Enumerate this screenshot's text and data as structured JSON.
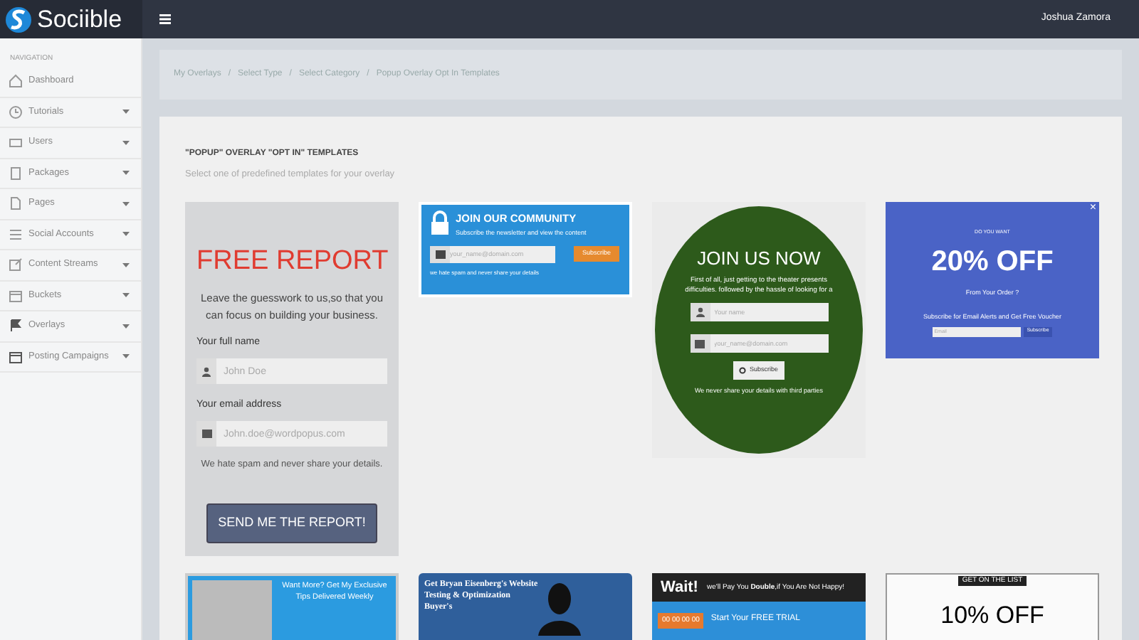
{
  "topbar": {
    "logo": "Sociible",
    "user": "Joshua Zamora"
  },
  "sidebar": {
    "heading": "NAVIGATION",
    "items": [
      {
        "label": "Dashboard",
        "expandable": false
      },
      {
        "label": "Tutorials",
        "expandable": true
      },
      {
        "label": "Users",
        "expandable": true
      },
      {
        "label": "Packages",
        "expandable": true
      },
      {
        "label": "Pages",
        "expandable": true
      },
      {
        "label": "Social Accounts",
        "expandable": true
      },
      {
        "label": "Content Streams",
        "expandable": true
      },
      {
        "label": "Buckets",
        "expandable": true
      },
      {
        "label": "Overlays",
        "expandable": true
      },
      {
        "label": "Posting Campaigns",
        "expandable": true
      }
    ]
  },
  "breadcrumb": {
    "items": [
      "My Overlays",
      "Select Type",
      "Select Category",
      "Popup Overlay Opt In Templates"
    ],
    "separators": [
      "/",
      "/",
      "/"
    ]
  },
  "panel": {
    "title": "\"POPUP\" OVERLAY \"OPT IN\" TEMPLATES",
    "subtitle": "Select one of predefined templates for your overlay"
  },
  "templates": [
    {
      "kind": "report",
      "title": "FREE REPORT",
      "text": "Leave the guesswork to us,so that you can focus on building your business.",
      "name_label": "Your full name",
      "name_placeholder": "John Doe",
      "email_label": "Your email address",
      "email_placeholder": "John.doe@wordpopus.com",
      "note": "We hate spam and never share your details.",
      "button": "SEND ME THE REPORT!"
    },
    {
      "kind": "community",
      "title": "JOIN OUR COMMUNITY",
      "text": "Subscribe the newsletter and view the content",
      "email_placeholder": "your_name@domain.com",
      "button": "Subscribe",
      "note": "we hate spam and never share your details"
    },
    {
      "kind": "circle",
      "title": "JOIN US NOW",
      "text": "First of all, just getting to the theater presents difficulties. followed by the hassle of looking for a",
      "name_placeholder": "Your name",
      "email_placeholder": "your_name@domain.com",
      "button": "Subscribe",
      "note": "We never share your details with third parties"
    },
    {
      "kind": "discount",
      "close": "×",
      "kicker": "DO YOU WANT",
      "title": "20% OFF",
      "text": "From Your Order ?",
      "note": "Subscribe for Email Alerts and Get Free Voucher",
      "email_placeholder": "Email",
      "button": "Subscribe"
    },
    {
      "kind": "tips",
      "title": "Want More? Get My Exclusive Tips Delivered Weekly"
    },
    {
      "kind": "guide",
      "title": "Get Bryan Eisenberg's Website Testing & Optimization Buyer's"
    },
    {
      "kind": "trial",
      "title": "Wait!",
      "text": "we'll Pay You **Double**,if You Are Not Happy!",
      "timer": "00 00 00 00",
      "button": "Start Your FREE TRIAL"
    },
    {
      "kind": "list",
      "kicker": "GET ON THE LIST",
      "title": "10% OFF"
    }
  ]
}
